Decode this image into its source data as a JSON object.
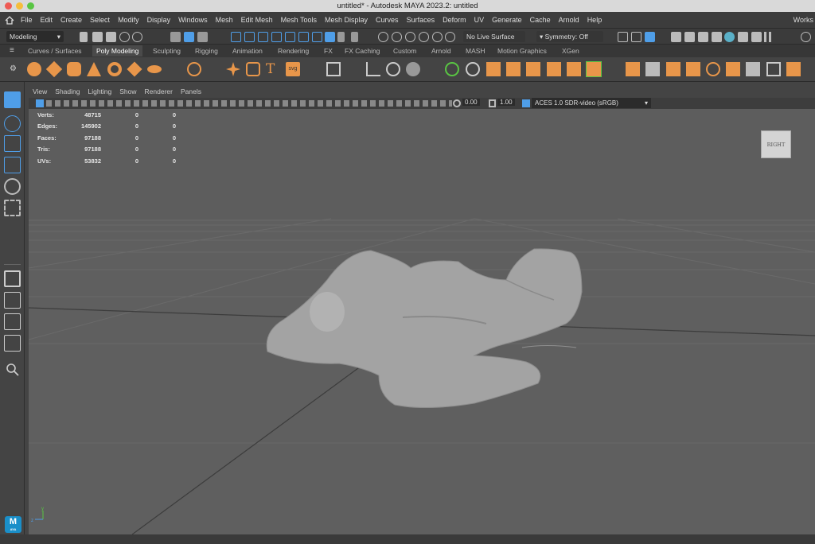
{
  "window": {
    "title": "untitled* - Autodesk MAYA 2023.2: untitled"
  },
  "menu": [
    "File",
    "Edit",
    "Create",
    "Select",
    "Modify",
    "Display",
    "Windows",
    "Mesh",
    "Edit Mesh",
    "Mesh Tools",
    "Mesh Display",
    "Curves",
    "Surfaces",
    "Deform",
    "UV",
    "Generate",
    "Cache",
    "Arnold",
    "Help"
  ],
  "menu_right": "Works",
  "status": {
    "mode": "Modeling",
    "live_surface": "No Live Surface",
    "symmetry": "Symmetry: Off"
  },
  "shelf_tabs": [
    "Curves / Surfaces",
    "Poly Modeling",
    "Sculpting",
    "Rigging",
    "Animation",
    "Rendering",
    "FX",
    "FX Caching",
    "Custom",
    "Arnold",
    "MASH",
    "Motion Graphics",
    "XGen"
  ],
  "active_shelf_tab": "Poly Modeling",
  "panel_menu": [
    "View",
    "Shading",
    "Lighting",
    "Show",
    "Renderer",
    "Panels"
  ],
  "panel_toolbar": {
    "gamma_value": "0.00",
    "exposure_value": "1.00",
    "color_space": "ACES 1.0 SDR-video (sRGB)"
  },
  "hud": {
    "rows": [
      {
        "label": "Verts:",
        "value": "48715",
        "sel": "0",
        "comp": "0"
      },
      {
        "label": "Edges:",
        "value": "145902",
        "sel": "0",
        "comp": "0"
      },
      {
        "label": "Faces:",
        "value": "97188",
        "sel": "0",
        "comp": "0"
      },
      {
        "label": "Tris:",
        "value": "97188",
        "sel": "0",
        "comp": "0"
      },
      {
        "label": "UVs:",
        "value": "53832",
        "sel": "0",
        "comp": "0"
      }
    ]
  },
  "view_cube": {
    "label": "RIGHT"
  },
  "colors": {
    "accent": "#e8964a",
    "blue": "#4f9ee8",
    "viewport": "#5f5f5f"
  },
  "icons": {
    "apple": "apple-icon",
    "home": "home-icon"
  },
  "logo": {
    "text": "M",
    "sub": "AYA"
  }
}
